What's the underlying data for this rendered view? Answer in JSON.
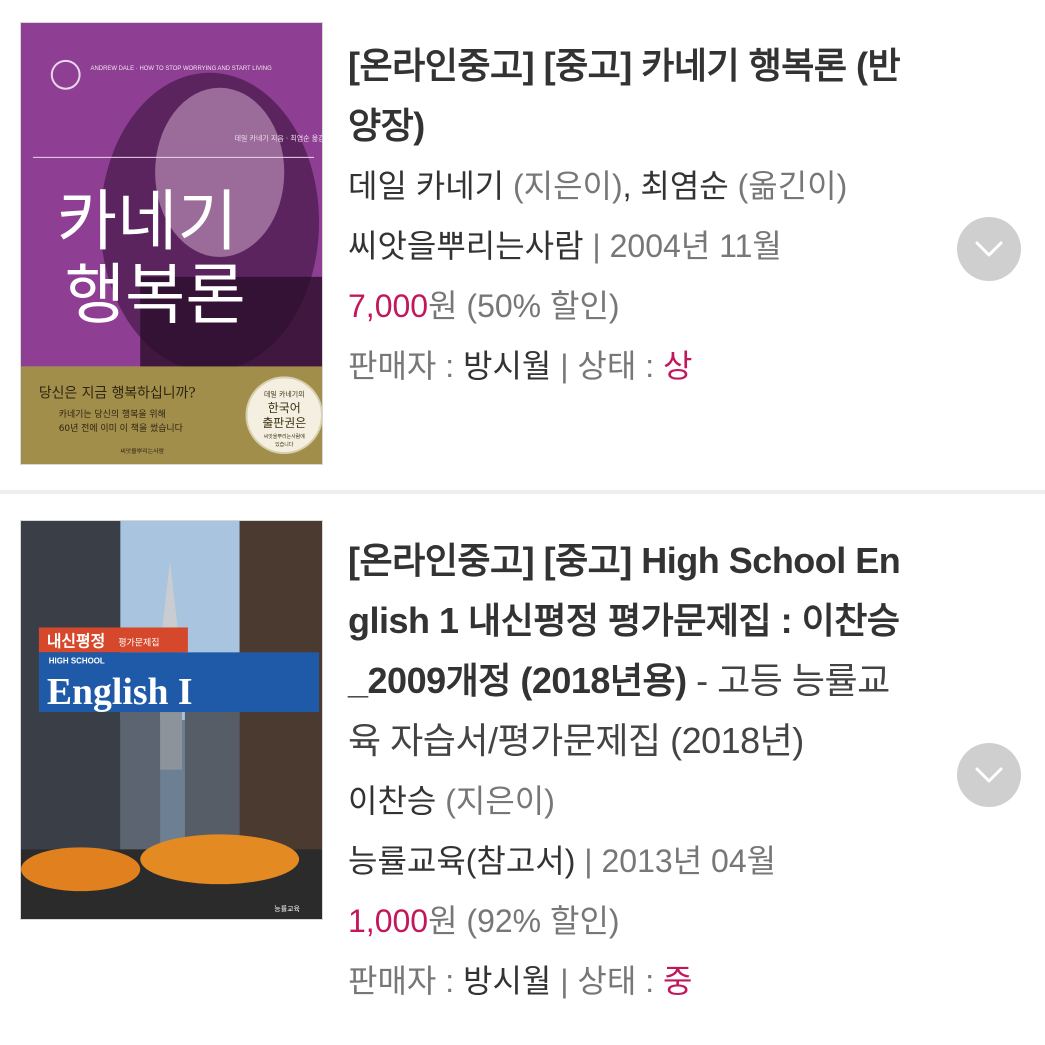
{
  "items": [
    {
      "title": "[온라인중고] [중고] 카네기 행복론 (반양장)",
      "title_line1": "[온라인중고] [중고] 카네기 행복론 (반",
      "title_line2": "양장)",
      "author": "데일 카네기",
      "author_role": "(지은이)",
      "sep": ",",
      "translator": "최염순",
      "translator_role": "(옮긴이)",
      "publisher": "씨앗을뿌리는사람",
      "pub_sep": " | ",
      "date": "2004년 11월",
      "price": "7,000",
      "price_unit": "원",
      "discount": "(50% 할인)",
      "seller_label": "판매자 : ",
      "seller": "방시월",
      "state_sep": " | ",
      "state_label": "상태 : ",
      "state": "상",
      "cover": {
        "top_text": "ANDREW DALE · HOW TO STOP WORRYING AND START LIVING",
        "title_line1": "카네기",
        "title_line2": "행복론",
        "small_author": "데일 카네기 지음 · 최염순 옮김",
        "band_main": "당신은 지금 행복하십니까?",
        "band_sub1": "카네기는 당신의 행복을 위해",
        "band_sub2": "60년 전에 이미 이 책을 썼습니다",
        "seal_line1": "데일 카네기의",
        "seal_line2": "한국어",
        "seal_line3": "출판권은",
        "seal_line4": "씨앗을뿌리는사람에",
        "seal_line5": "있습니다",
        "publisher_mark": "씨앗을뿌리는사람"
      }
    },
    {
      "title_line1": "[온라인중고] [중고] High School En",
      "title_line2": "glish 1 내신평정 평가문제집 : 이찬승",
      "title_line3_bold": "_2009개정 (2018년용)",
      "title_line3_rest": " - 고등 능률교",
      "title_line4": "육 자습서/평가문제집 (2018년)",
      "author": "이찬승",
      "author_role": "(지은이)",
      "publisher": "능률교육(참고서)",
      "pub_sep": " | ",
      "date": "2013년 04월",
      "price": "1,000",
      "price_unit": "원",
      "discount": "(92% 할인)",
      "seller_label": "판매자 : ",
      "seller": "방시월",
      "state_sep": " | ",
      "state_label": "상태 : ",
      "state": "중",
      "cover": {
        "banner_title": "내신평정",
        "banner_sub": "평가문제집",
        "school": "HIGH SCHOOL",
        "english": "English I",
        "publisher_mark": "능률교육"
      }
    }
  ],
  "icons": {
    "expand": "chevron-down-icon"
  },
  "colors": {
    "price": "#c2185b",
    "state": "#c2185b",
    "button": "#cfcfcf"
  }
}
